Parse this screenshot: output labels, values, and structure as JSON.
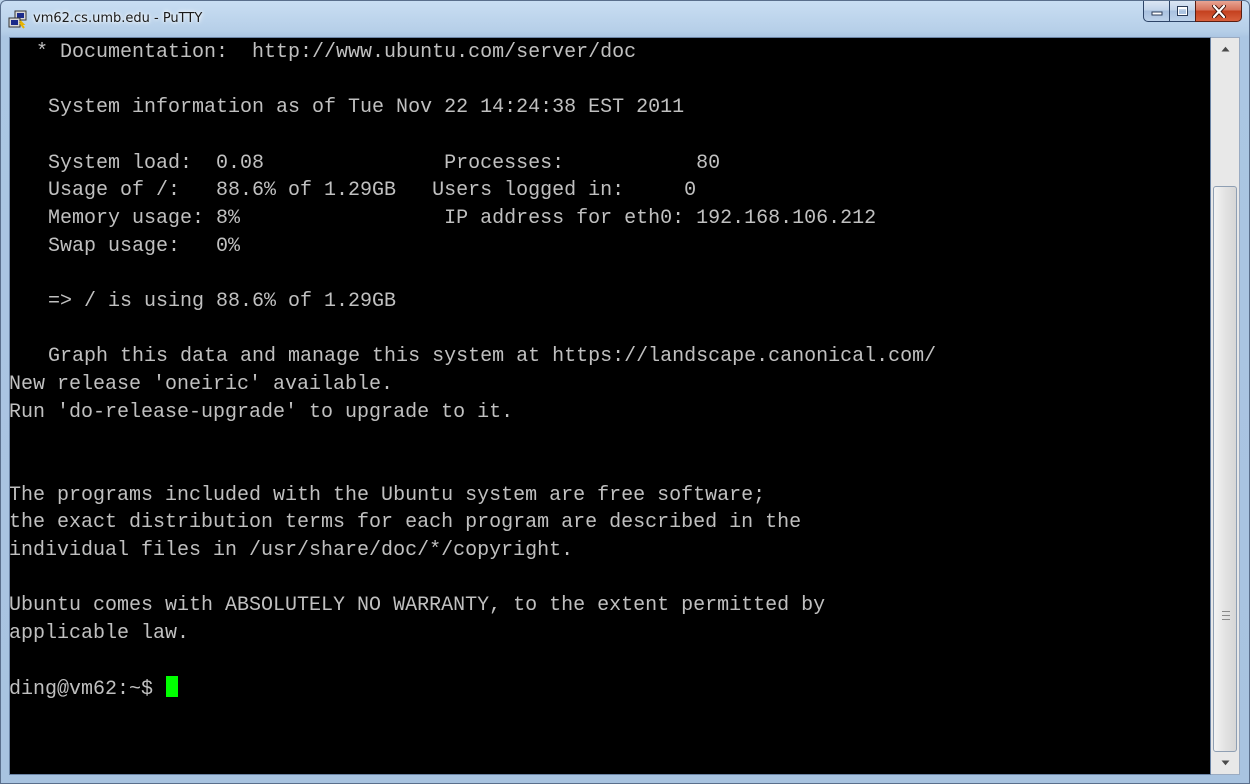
{
  "window": {
    "title": "vm62.cs.umb.edu - PuTTY",
    "icon": "putty-app-icon",
    "buttons": {
      "minimize": "minimize-icon",
      "maximize": "maximize-icon",
      "close": "close-icon"
    }
  },
  "terminal": {
    "background": "#000000",
    "foreground": "#c0c0c0",
    "cursor_color": "#00ff00",
    "lines": [
      " * Documentation:  http://www.ubuntu.com/server/doc",
      "",
      "  System information as of Tue Nov 22 14:24:38 EST 2011",
      "",
      "  System load:  0.08               Processes:           80",
      "  Usage of /:   88.6% of 1.29GB   Users logged in:     0",
      "  Memory usage: 8%                 IP address for eth0: 192.168.106.212",
      "  Swap usage:   0%",
      "",
      "  => / is using 88.6% of 1.29GB",
      "",
      "  Graph this data and manage this system at https://landscape.canonical.com/",
      "New release 'oneiric' available.",
      "Run 'do-release-upgrade' to upgrade to it.",
      "",
      "",
      "The programs included with the Ubuntu system are free software;",
      "the exact distribution terms for each program are described in the",
      "individual files in /usr/share/doc/*/copyright.",
      "",
      "Ubuntu comes with ABSOLUTELY NO WARRANTY, to the extent permitted by",
      "applicable law.",
      ""
    ],
    "prompt": "ding@vm62:~$ "
  },
  "scrollbar": {
    "up": "scroll-up-arrow-icon",
    "down": "scroll-down-arrow-icon"
  }
}
